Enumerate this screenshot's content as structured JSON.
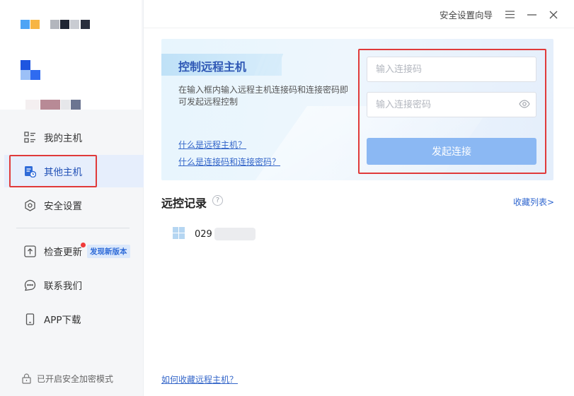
{
  "topbar": {
    "guide_label": "安全设置向导",
    "menu_icon": "menu-icon",
    "minimize_icon": "minimize-icon",
    "close_icon": "close-icon"
  },
  "sidebar": {
    "items": [
      {
        "label": "我的主机",
        "icon": "host-list-icon"
      },
      {
        "label": "其他主机",
        "icon": "remote-host-icon",
        "active": true
      },
      {
        "label": "安全设置",
        "icon": "shield-hex-icon"
      },
      {
        "label": "检查更新",
        "icon": "upload-icon",
        "badge": "发现新版本"
      },
      {
        "label": "联系我们",
        "icon": "chat-icon"
      },
      {
        "label": "APP下载",
        "icon": "phone-icon"
      }
    ],
    "footer": "已开启安全加密模式"
  },
  "panel": {
    "title": "控制远程主机",
    "desc": "在输入框内输入远程主机连接码和连接密码即可发起远程控制",
    "link1": "什么是远程主机？",
    "link2": "什么是连接码和连接密码？",
    "code_placeholder": "输入连接码",
    "password_placeholder": "输入连接密码",
    "connect_label": "发起连接"
  },
  "records": {
    "title": "远控记录",
    "help": "?",
    "fav_link": "收藏列表>",
    "items": [
      {
        "id": "029",
        "os_icon": "windows-icon"
      }
    ]
  },
  "bottom_link": "如何收藏远程主机？",
  "colors": {
    "accent": "#2f66cf",
    "highlight_box": "#e03a3a",
    "connect_button": "#8bb8f3",
    "active_nav_bg": "#e6eefc"
  }
}
